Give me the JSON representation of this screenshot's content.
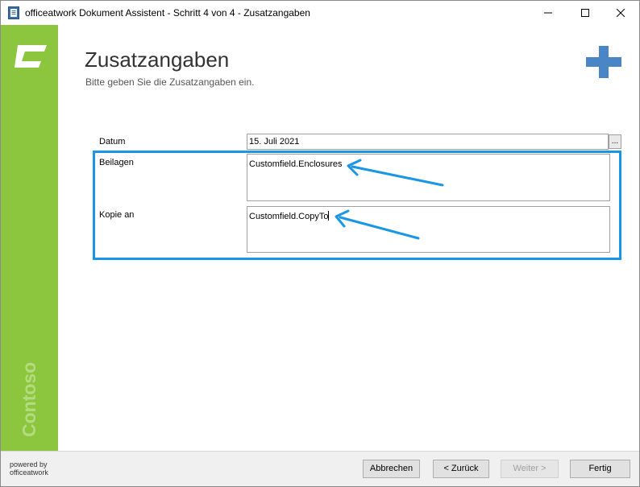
{
  "window": {
    "title": "officeatwork Dokument Assistent - Schritt 4 von 4 - Zusatzangaben"
  },
  "sidebar": {
    "brand": "Contoso"
  },
  "header": {
    "title": "Zusatzangaben",
    "subtitle": "Bitte geben Sie die Zusatzangaben ein."
  },
  "form": {
    "date_label": "Datum",
    "date_value": "15. Juli 2021",
    "date_button": "...",
    "enclosures_label": "Beilagen",
    "enclosures_value": "Customfield.Enclosures",
    "copy_label": "Kopie an",
    "copy_value": "Customfield.CopyTo"
  },
  "footer": {
    "powered_line1": "powered by",
    "powered_line2": "officeatwork",
    "cancel": "Abbrechen",
    "back": "< Zurück",
    "next": "Weiter >",
    "finish": "Fertig"
  },
  "colors": {
    "sidebar": "#8cc63f",
    "accent": "#1a96e6",
    "plus": "#4a86c5"
  }
}
